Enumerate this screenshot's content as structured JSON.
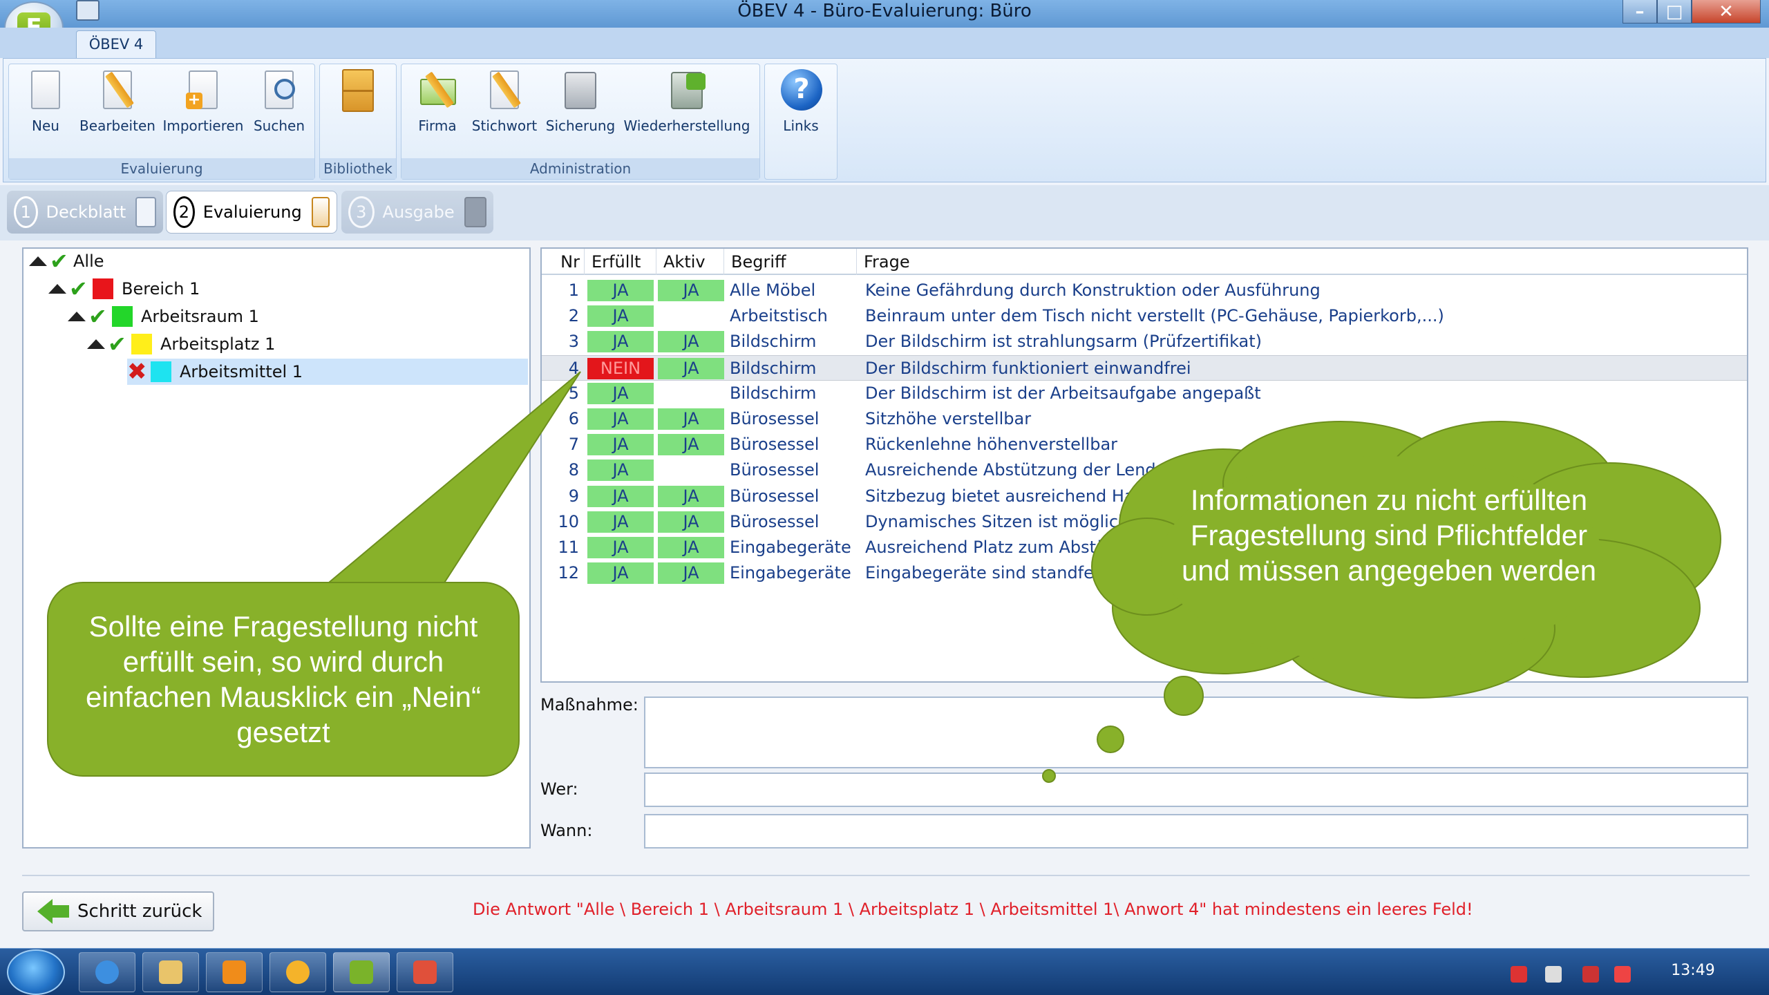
{
  "window": {
    "title": "ÖBEV 4 - Büro-Evaluierung: Büro",
    "app_logo": "E"
  },
  "ribbon": {
    "tab": "ÖBEV 4",
    "groups": {
      "evaluierung": "Evaluierung",
      "bibliothek": "Bibliothek",
      "administration": "Administration"
    },
    "buttons": {
      "neu": "Neu",
      "bearbeiten": "Bearbeiten",
      "importieren": "Importieren",
      "suchen": "Suchen",
      "firma": "Firma",
      "stichwort": "Stichwort",
      "sicherung": "Sicherung",
      "wiederherstellung": "Wiederherstellung",
      "links": "Links"
    }
  },
  "wizard": {
    "steps": [
      {
        "num": "1",
        "label": "Deckblatt"
      },
      {
        "num": "2",
        "label": "Evaluierung"
      },
      {
        "num": "3",
        "label": "Ausgabe"
      }
    ],
    "active_step": "2"
  },
  "tree": [
    {
      "label": "Alle",
      "status": "ok",
      "color": null
    },
    {
      "label": "Bereich 1",
      "status": "ok",
      "color": "#e8151b"
    },
    {
      "label": "Arbeitsraum 1",
      "status": "ok",
      "color": "#23d62a"
    },
    {
      "label": "Arbeitsplatz 1",
      "status": "ok",
      "color": "#ffee1a"
    },
    {
      "label": "Arbeitsmittel 1",
      "status": "error",
      "color": "#1ee3f0",
      "selected": true
    }
  ],
  "table": {
    "headers": {
      "nr": "Nr",
      "erfuellt": "Erfüllt",
      "aktiv": "Aktiv",
      "begriff": "Begriff",
      "frage": "Frage"
    },
    "rows": [
      {
        "nr": "1",
        "erfuellt": "JA",
        "aktiv": "JA",
        "begriff": "Alle Möbel",
        "frage": "Keine Gefährdung durch Konstruktion oder Ausführung"
      },
      {
        "nr": "2",
        "erfuellt": "JA",
        "aktiv": "",
        "begriff": "Arbeitstisch",
        "frage": "Beinraum unter dem Tisch nicht verstellt (PC-Gehäuse, Papierkorb,...)"
      },
      {
        "nr": "3",
        "erfuellt": "JA",
        "aktiv": "JA",
        "begriff": "Bildschirm",
        "frage": "Der Bildschirm ist strahlungsarm (Prüfzertifikat)"
      },
      {
        "nr": "4",
        "erfuellt": "NEIN",
        "aktiv": "JA",
        "begriff": "Bildschirm",
        "frage": "Der Bildschirm funktioniert einwandfrei",
        "selected": true
      },
      {
        "nr": "5",
        "erfuellt": "JA",
        "aktiv": "",
        "begriff": "Bildschirm",
        "frage": "Der Bildschirm ist der Arbeitsaufgabe angepaßt"
      },
      {
        "nr": "6",
        "erfuellt": "JA",
        "aktiv": "JA",
        "begriff": "Bürosessel",
        "frage": "Sitzhöhe verstellbar"
      },
      {
        "nr": "7",
        "erfuellt": "JA",
        "aktiv": "JA",
        "begriff": "Bürosessel",
        "frage": "Rückenlehne höhenverstellbar"
      },
      {
        "nr": "8",
        "erfuellt": "JA",
        "aktiv": "",
        "begriff": "Bürosessel",
        "frage": "Ausreichende Abstützung der Lendenwirbel"
      },
      {
        "nr": "9",
        "erfuellt": "JA",
        "aktiv": "JA",
        "begriff": "Bürosessel",
        "frage": "Sitzbezug bietet ausreichend Halt"
      },
      {
        "nr": "10",
        "erfuellt": "JA",
        "aktiv": "JA",
        "begriff": "Bürosessel",
        "frage": "Dynamisches Sitzen ist möglich (Bü"
      },
      {
        "nr": "11",
        "erfuellt": "JA",
        "aktiv": "JA",
        "begriff": "Eingabegeräte",
        "frage": "Ausreichend Platz zum Abstüt"
      },
      {
        "nr": "12",
        "erfuellt": "JA",
        "aktiv": "JA",
        "begriff": "Eingabegeräte",
        "frage": "Eingabegeräte sind standfest, r"
      }
    ]
  },
  "form": {
    "massnahme_label": "Maßnahme:",
    "wer_label": "Wer:",
    "wann_label": "Wann:",
    "massnahme_value": "",
    "wer_value": "",
    "wann_value": ""
  },
  "footer": {
    "back_button": "Schritt zurück",
    "error_message": "Die Antwort \"Alle \\ Bereich 1 \\ Arbeitsraum 1 \\ Arbeitsplatz 1 \\ Arbeitsmittel 1\\ Anwort 4\" hat mindestens ein leeres Feld!"
  },
  "annotations": {
    "left_callout": "Sollte eine Fragestellung nicht erfüllt sein, so wird durch einfachen Mausklick ein „Nein“ gesetzt",
    "cloud": "Informationen zu nicht erfüllten Fragestellung sind Pflichtfelder und müssen angegeben werden",
    "color": "#88b12a"
  },
  "taskbar": {
    "clock": "13:49"
  }
}
